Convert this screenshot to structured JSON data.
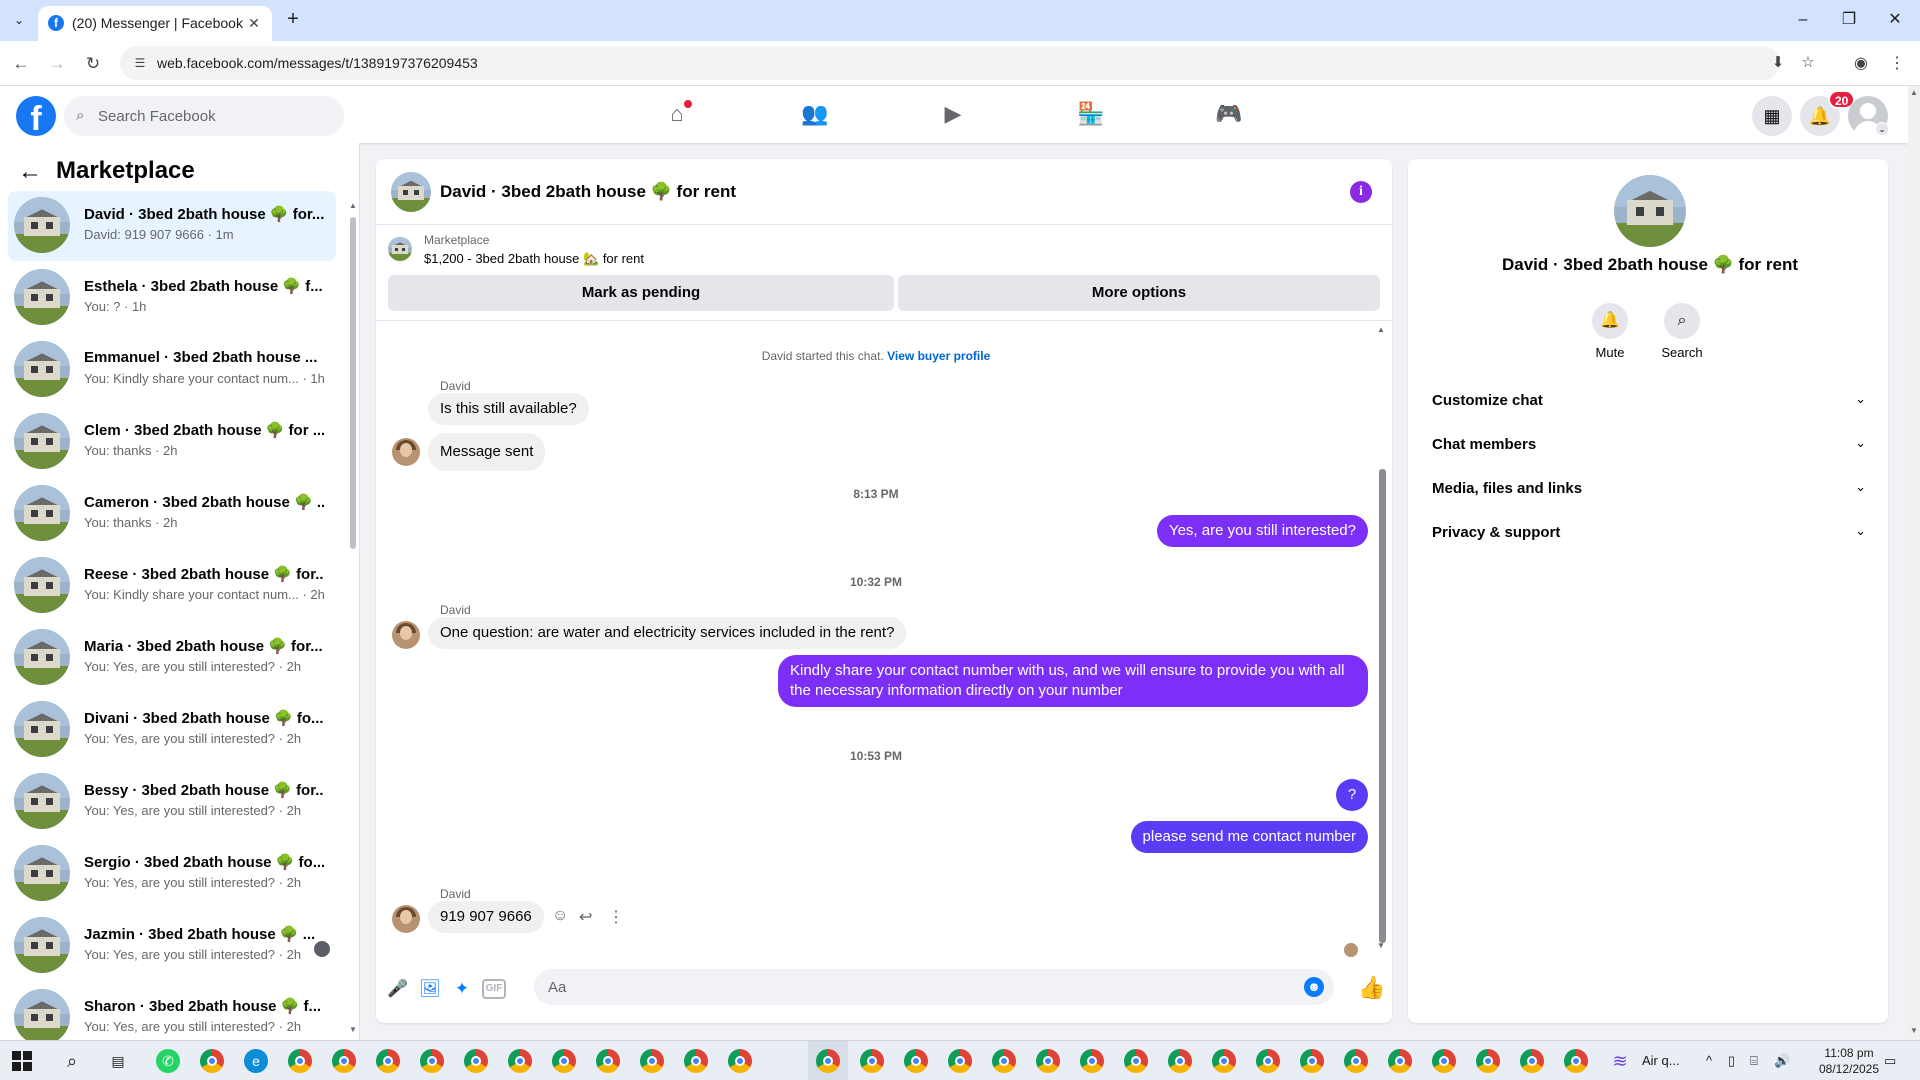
{
  "browser": {
    "tab_title": "(20) Messenger | Facebook",
    "url": "web.facebook.com/messages/t/1389197376209453"
  },
  "fb": {
    "search_placeholder": "Search Facebook",
    "notifications_count": "20",
    "brand_color": "#1877f2"
  },
  "sidebar": {
    "title": "Marketplace",
    "conversations": [
      {
        "name": "David · 3bed 2bath house 🌳 for...",
        "preview": "David: 919 907 9666 · 1m",
        "active": true
      },
      {
        "name": "Esthela · 3bed 2bath house 🌳 f...",
        "preview": "You: ? · 1h"
      },
      {
        "name": "Emmanuel · 3bed 2bath house ...",
        "preview": "You: Kindly share your contact num... · 1h"
      },
      {
        "name": "Clem · 3bed 2bath house 🌳 for ...",
        "preview": "You: thanks · 2h"
      },
      {
        "name": "Cameron · 3bed 2bath house 🌳 ...",
        "preview": "You: thanks · 2h"
      },
      {
        "name": "Reese · 3bed 2bath house 🌳 for...",
        "preview": "You: Kindly share your contact num... · 2h"
      },
      {
        "name": "Maria · 3bed 2bath house 🌳 for...",
        "preview": "You: Yes, are you still interested? · 2h"
      },
      {
        "name": "Divani · 3bed 2bath house 🌳 fo...",
        "preview": "You: Yes, are you still interested? · 2h"
      },
      {
        "name": "Bessy · 3bed 2bath house 🌳 for...",
        "preview": "You: Yes, are you still interested? · 2h"
      },
      {
        "name": "Sergio · 3bed 2bath house 🌳 fo...",
        "preview": "You: Yes, are you still interested? · 2h"
      },
      {
        "name": "Jazmin · 3bed 2bath house 🌳 ...",
        "preview": "You: Yes, are you still interested? · 2h"
      },
      {
        "name": "Sharon · 3bed 2bath house 🌳 f...",
        "preview": "You: Yes, are you still interested? · 2h"
      }
    ]
  },
  "chat": {
    "title": "David · 3bed 2bath house 🌳 for rent",
    "listing_label": "Marketplace",
    "listing_title": "$1,200 - 3bed 2bath house 🏡 for rent",
    "mark_pending": "Mark as pending",
    "more_options": "More options",
    "started_text": "David started this chat.",
    "view_buyer_profile": "View buyer profile",
    "sender_name": "David",
    "messages": {
      "m1": "Is this still available?",
      "m2": "Message sent",
      "t1": "8:13 PM",
      "m3": "Yes, are you still interested?",
      "t2": "10:32 PM",
      "m4": "One question: are water and electricity services included in the rent?",
      "m5": "Kindly share your contact number with us, and we will ensure to provide you with all the necessary information directly on your number",
      "t3": "10:53 PM",
      "m6": "?",
      "m7": "please send me contact number",
      "m8": "919 907 9666"
    },
    "composer_placeholder": "Aa",
    "outgoing_color": "#7b2ff7"
  },
  "info_panel": {
    "name": "David · 3bed 2bath house 🌳 for rent",
    "mute_label": "Mute",
    "search_label": "Search",
    "sections": [
      "Customize chat",
      "Chat members",
      "Media, files and links",
      "Privacy & support"
    ]
  },
  "taskbar": {
    "weather": "Air q...",
    "time": "11:08 pm",
    "date": "08/12/2025"
  }
}
